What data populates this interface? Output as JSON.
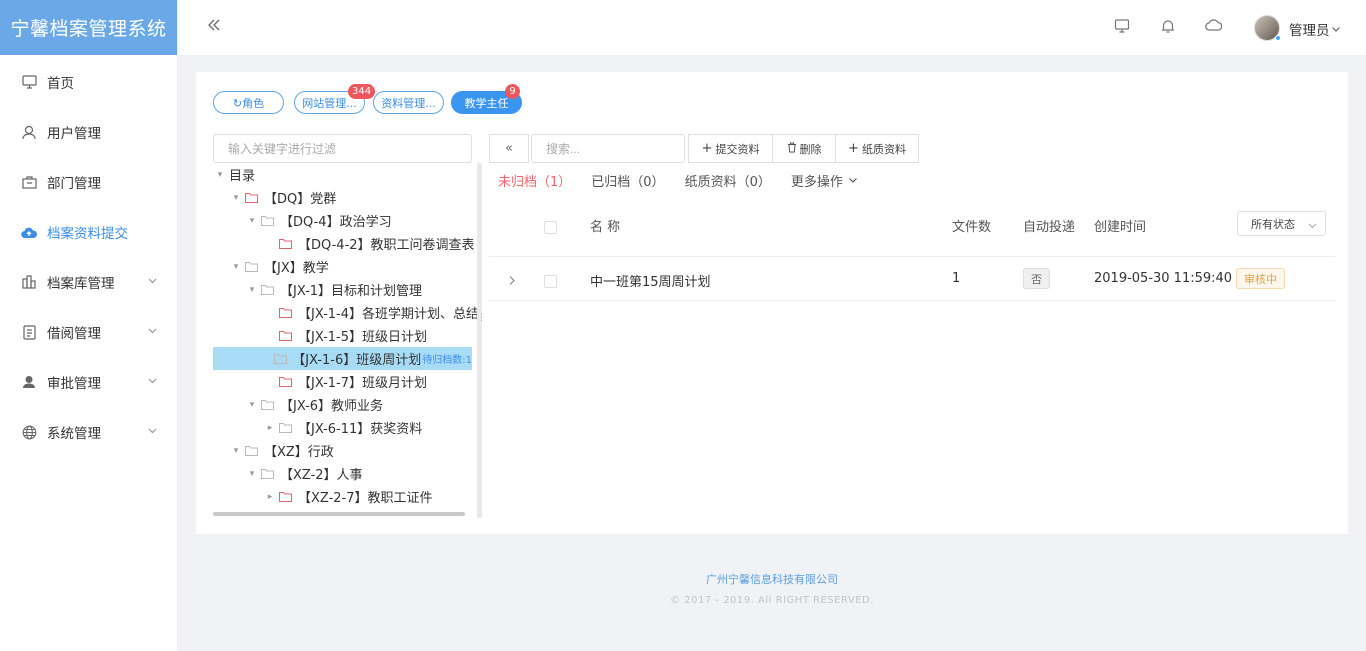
{
  "app": {
    "title": "宁馨档案管理系统"
  },
  "sidebar": {
    "items": [
      {
        "label": "首页",
        "icon": "monitor-icon"
      },
      {
        "label": "用户管理",
        "icon": "user-icon"
      },
      {
        "label": "部门管理",
        "icon": "department-icon"
      },
      {
        "label": "档案资料提交",
        "icon": "cloud-upload-icon",
        "active": true
      },
      {
        "label": "档案库管理",
        "icon": "archive-icon",
        "has_submenu": true
      },
      {
        "label": "借阅管理",
        "icon": "document-icon",
        "has_submenu": true
      },
      {
        "label": "审批管理",
        "icon": "approver-icon",
        "has_submenu": true
      },
      {
        "label": "系统管理",
        "icon": "globe-icon",
        "has_submenu": true
      }
    ]
  },
  "header": {
    "username": "管理员",
    "icons": [
      "monitor-icon",
      "bell-icon",
      "cloud-icon"
    ]
  },
  "tags": [
    {
      "label": "↻角色"
    },
    {
      "label": "网站管理...",
      "badge": "344"
    },
    {
      "label": "资料管理..."
    },
    {
      "label": "教学主任",
      "badge": "9",
      "active": true
    }
  ],
  "tree": {
    "filter_placeholder": "输入关键字进行过滤",
    "nodes": [
      {
        "label": "目录",
        "caret": "▾"
      },
      {
        "label": "【DQ】党群",
        "caret": "▾"
      },
      {
        "label": "【DQ-4】政治学习",
        "caret": "▾"
      },
      {
        "label": "【DQ-4-2】教职工问卷调查表",
        "caret": ""
      },
      {
        "label": "【JX】教学",
        "caret": "▾"
      },
      {
        "label": "【JX-1】目标和计划管理",
        "caret": "▾"
      },
      {
        "label": "【JX-1-4】各班学期计划、总结",
        "caret": ""
      },
      {
        "label": "【JX-1-5】班级日计划",
        "caret": ""
      },
      {
        "label": "【JX-1-6】班级周计划",
        "caret": "",
        "badge": "待归档数:1",
        "selected": true
      },
      {
        "label": "【JX-1-7】班级月计划",
        "caret": ""
      },
      {
        "label": "【JX-6】教师业务",
        "caret": "▾"
      },
      {
        "label": "【JX-6-11】获奖资料",
        "caret": "▸"
      },
      {
        "label": "【XZ】行政",
        "caret": "▾"
      },
      {
        "label": "【XZ-2】人事",
        "caret": "▾"
      },
      {
        "label": "【XZ-2-7】教职工证件",
        "caret": "▸"
      }
    ]
  },
  "toolbar": {
    "collapse_label": "«",
    "search_placeholder": "搜索...",
    "submit_label": "提交资料",
    "delete_label": "删除",
    "paper_label": "纸质资料"
  },
  "tabs": [
    {
      "label": "未归档（1）",
      "active": true
    },
    {
      "label": "已归档（0）"
    },
    {
      "label": "纸质资料（0）"
    },
    {
      "label": "更多操作"
    }
  ],
  "table": {
    "headers": {
      "name": "名 称",
      "files": "文件数",
      "auto_push": "自动投递",
      "created": "创建时间"
    },
    "status_filter": "所有状态",
    "rows": [
      {
        "name": "中一班第15周周计划",
        "files": "1",
        "auto_push": "否",
        "created": "2019-05-30 11:59:40",
        "status": "审核中"
      }
    ]
  },
  "footer": {
    "company": "广州宁馨信息科技有限公司",
    "copyright": "© 2017 - 2019. All RIGHT RESERVED."
  },
  "colors": {
    "brand": "#6ba8e8",
    "accent": "#3a8ee6",
    "active_tab": "#f0656e",
    "badge": "#f0565e",
    "selected_row": "#a8dcf6"
  }
}
